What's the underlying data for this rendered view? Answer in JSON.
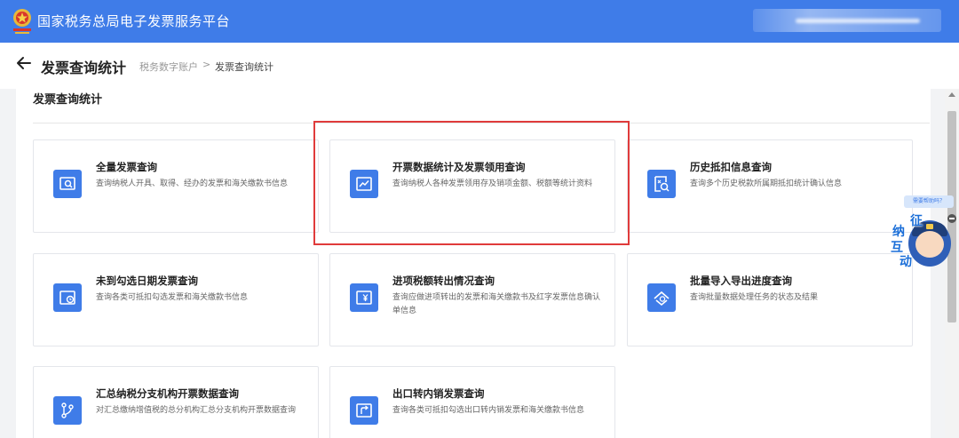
{
  "header": {
    "site_title": "国家税务总局电子发票服务平台"
  },
  "breadcrumb": {
    "page_title": "发票查询统计",
    "items": [
      "税务数字账户",
      "发票查询统计"
    ],
    "separator": ">"
  },
  "section": {
    "title": "发票查询统计"
  },
  "cards": [
    {
      "title": "全量发票查询",
      "desc": "查询纳税人开具、取得、经办的发票和海关缴款书信息",
      "icon": "search-receipt-icon"
    },
    {
      "title": "开票数据统计及发票领用查询",
      "desc": "查询纳税人各种发票领用存及销项金额、税额等统计资料",
      "icon": "chart-line-icon"
    },
    {
      "title": "历史抵扣信息查询",
      "desc": "查询多个历史税款所属期抵扣统计确认信息",
      "icon": "history-search-icon"
    },
    {
      "title": "未到勾选日期发票查询",
      "desc": "查询各类可抵扣勾选发票和海关缴款书信息",
      "icon": "clock-receipt-icon"
    },
    {
      "title": "进项税额转出情况查询",
      "desc": "查询应做进项转出的发票和海关缴款书及红字发票信息确认单信息",
      "icon": "yen-receipt-icon"
    },
    {
      "title": "批量导入导出进度查询",
      "desc": "查询批量数据处理任务的状态及结果",
      "icon": "batch-progress-icon"
    },
    {
      "title": "汇总纳税分支机构开票数据查询",
      "desc": "对汇总缴纳增值税的总分机构汇总分支机构开票数据查询",
      "icon": "branch-icon"
    },
    {
      "title": "出口转内销发票查询",
      "desc": "查询各类可抵扣勾选出口转内销发票和海关缴款书信息",
      "icon": "export-receipt-icon"
    }
  ],
  "assistant": {
    "tip": "需要帮助吗？",
    "chars": [
      "征",
      "纳",
      "互",
      "动"
    ]
  },
  "colors": {
    "brand": "#3f7ce8",
    "highlight": "#e03b3b"
  }
}
